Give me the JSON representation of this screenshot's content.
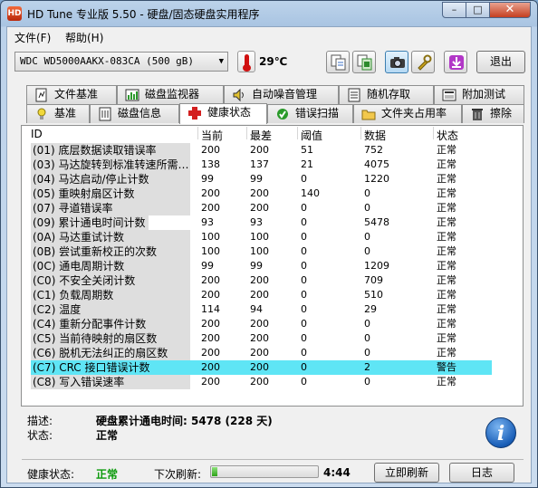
{
  "window": {
    "title": "HD Tune 专业版 5.50 - 硬盘/固态硬盘实用程序",
    "app_icon": "hd-tune-icon",
    "minimize": "–",
    "maximize": "□",
    "close": "✕"
  },
  "menu": {
    "file": "文件(F)",
    "help": "帮助(H)"
  },
  "toolbar": {
    "drive": "WDC WD5000AAKX-083CA (500 gB)",
    "temperature": "29℃",
    "exit_label": "退出",
    "icons": [
      "copy-info-icon",
      "copy-screenshot-icon",
      "camera-icon",
      "options-tools-icon",
      "save-download-icon"
    ]
  },
  "tabs": {
    "row1": [
      {
        "label": "文件基准",
        "icon": "file-benchmark-icon"
      },
      {
        "label": "磁盘监视器",
        "icon": "disk-monitor-icon"
      },
      {
        "label": "自动噪音管理",
        "icon": "speaker-icon"
      },
      {
        "label": "随机存取",
        "icon": "random-access-icon"
      },
      {
        "label": "附加测试",
        "icon": "extra-tests-icon"
      }
    ],
    "row2": [
      {
        "label": "基准",
        "icon": "benchmark-icon"
      },
      {
        "label": "磁盘信息",
        "icon": "disk-info-icon"
      },
      {
        "label": "健康状态",
        "icon": "health-cross-icon"
      },
      {
        "label": "错误扫描",
        "icon": "error-scan-icon"
      },
      {
        "label": "文件夹占用率",
        "icon": "folder-icon"
      },
      {
        "label": "擦除",
        "icon": "trash-icon"
      }
    ]
  },
  "table": {
    "headers": [
      "ID",
      "当前",
      "最差",
      "阈值",
      "数据",
      "状态"
    ],
    "rows": [
      {
        "id": "(01) 底层数据读取错误率",
        "current": "200",
        "worst": "200",
        "threshold": "51",
        "data": "752",
        "status": "正常"
      },
      {
        "id": "(03) 马达旋转到标准转速所需…",
        "current": "138",
        "worst": "137",
        "threshold": "21",
        "data": "4075",
        "status": "正常"
      },
      {
        "id": "(04) 马达启动/停止计数",
        "current": "99",
        "worst": "99",
        "threshold": "0",
        "data": "1220",
        "status": "正常"
      },
      {
        "id": "(05) 重映射扇区计数",
        "current": "200",
        "worst": "200",
        "threshold": "140",
        "data": "0",
        "status": "正常"
      },
      {
        "id": "(07) 寻道错误率",
        "current": "200",
        "worst": "200",
        "threshold": "0",
        "data": "0",
        "status": "正常"
      },
      {
        "id": "(09) 累计通电时间计数",
        "current": "93",
        "worst": "93",
        "threshold": "0",
        "data": "5478",
        "status": "正常"
      },
      {
        "id": "(0A) 马达重试计数",
        "current": "100",
        "worst": "100",
        "threshold": "0",
        "data": "0",
        "status": "正常"
      },
      {
        "id": "(0B) 尝试重新校正的次数",
        "current": "100",
        "worst": "100",
        "threshold": "0",
        "data": "0",
        "status": "正常"
      },
      {
        "id": "(0C) 通电周期计数",
        "current": "99",
        "worst": "99",
        "threshold": "0",
        "data": "1209",
        "status": "正常"
      },
      {
        "id": "(C0) 不安全关闭计数",
        "current": "200",
        "worst": "200",
        "threshold": "0",
        "data": "709",
        "status": "正常"
      },
      {
        "id": "(C1) 负载周期数",
        "current": "200",
        "worst": "200",
        "threshold": "0",
        "data": "510",
        "status": "正常"
      },
      {
        "id": "(C2) 温度",
        "current": "114",
        "worst": "94",
        "threshold": "0",
        "data": "29",
        "status": "正常"
      },
      {
        "id": "(C4) 重新分配事件计数",
        "current": "200",
        "worst": "200",
        "threshold": "0",
        "data": "0",
        "status": "正常"
      },
      {
        "id": "(C5) 当前待映射的扇区数",
        "current": "200",
        "worst": "200",
        "threshold": "0",
        "data": "0",
        "status": "正常"
      },
      {
        "id": "(C6) 脱机无法纠正的扇区数",
        "current": "200",
        "worst": "200",
        "threshold": "0",
        "data": "0",
        "status": "正常"
      },
      {
        "id": "(C7) CRC 接口错误计数",
        "current": "200",
        "worst": "200",
        "threshold": "0",
        "data": "2",
        "status": "警告"
      },
      {
        "id": "(C8) 写入错误速率",
        "current": "200",
        "worst": "200",
        "threshold": "0",
        "data": "0",
        "status": "正常"
      }
    ],
    "selected_index": 15,
    "selected_color": "#5fe5f5"
  },
  "details": {
    "desc_label": "描述:",
    "desc_value": "硬盘累计通电时间: 5478 (228 天)",
    "status_label": "状态:",
    "status_value": "正常"
  },
  "footer": {
    "health_label": "健康状态:",
    "health_value": "正常",
    "health_color": "#0a9a0a",
    "next_refresh_label": "下次刷新:",
    "refresh_progress": 0.05,
    "countdown": "4:44",
    "refresh_now_label": "立即刷新",
    "log_label": "日志",
    "info_icon": "info-icon"
  }
}
